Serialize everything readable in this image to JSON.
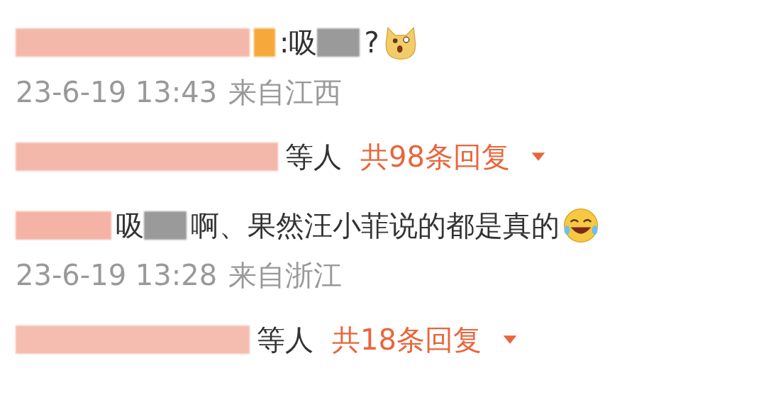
{
  "comments": [
    {
      "content": [
        {
          "kind": "name",
          "color": "#f4b8aa"
        },
        {
          "kind": "badge",
          "color": "#f6a93a"
        },
        {
          "kind": "text",
          "text": ":吸"
        },
        {
          "kind": "word",
          "color": "#9a9a9a"
        },
        {
          "kind": "text",
          "text": "?"
        },
        {
          "kind": "dog"
        }
      ],
      "time": "23-6-19 13:43",
      "location": "来自江西",
      "replies": {
        "repliers": [
          {
            "color": "#f4b8aa"
          }
        ],
        "suffix": "等人",
        "count": "共98条回复",
        "expanded": false
      }
    },
    {
      "content": [
        {
          "kind": "name",
          "color": "#f4b3a4"
        },
        {
          "kind": "text",
          "text": "吸"
        },
        {
          "kind": "word",
          "color": "#9a9a9a"
        },
        {
          "kind": "text",
          "text": "啊、果然汪小菲说的都是真的"
        },
        {
          "kind": "laugh"
        }
      ],
      "time": "23-6-19 13:28",
      "location": "来自浙江",
      "replies": {
        "repliers": [
          {
            "color": "#f4bdb0"
          }
        ],
        "suffix": "等人",
        "count": "共18条回复",
        "expanded": false
      }
    }
  ]
}
